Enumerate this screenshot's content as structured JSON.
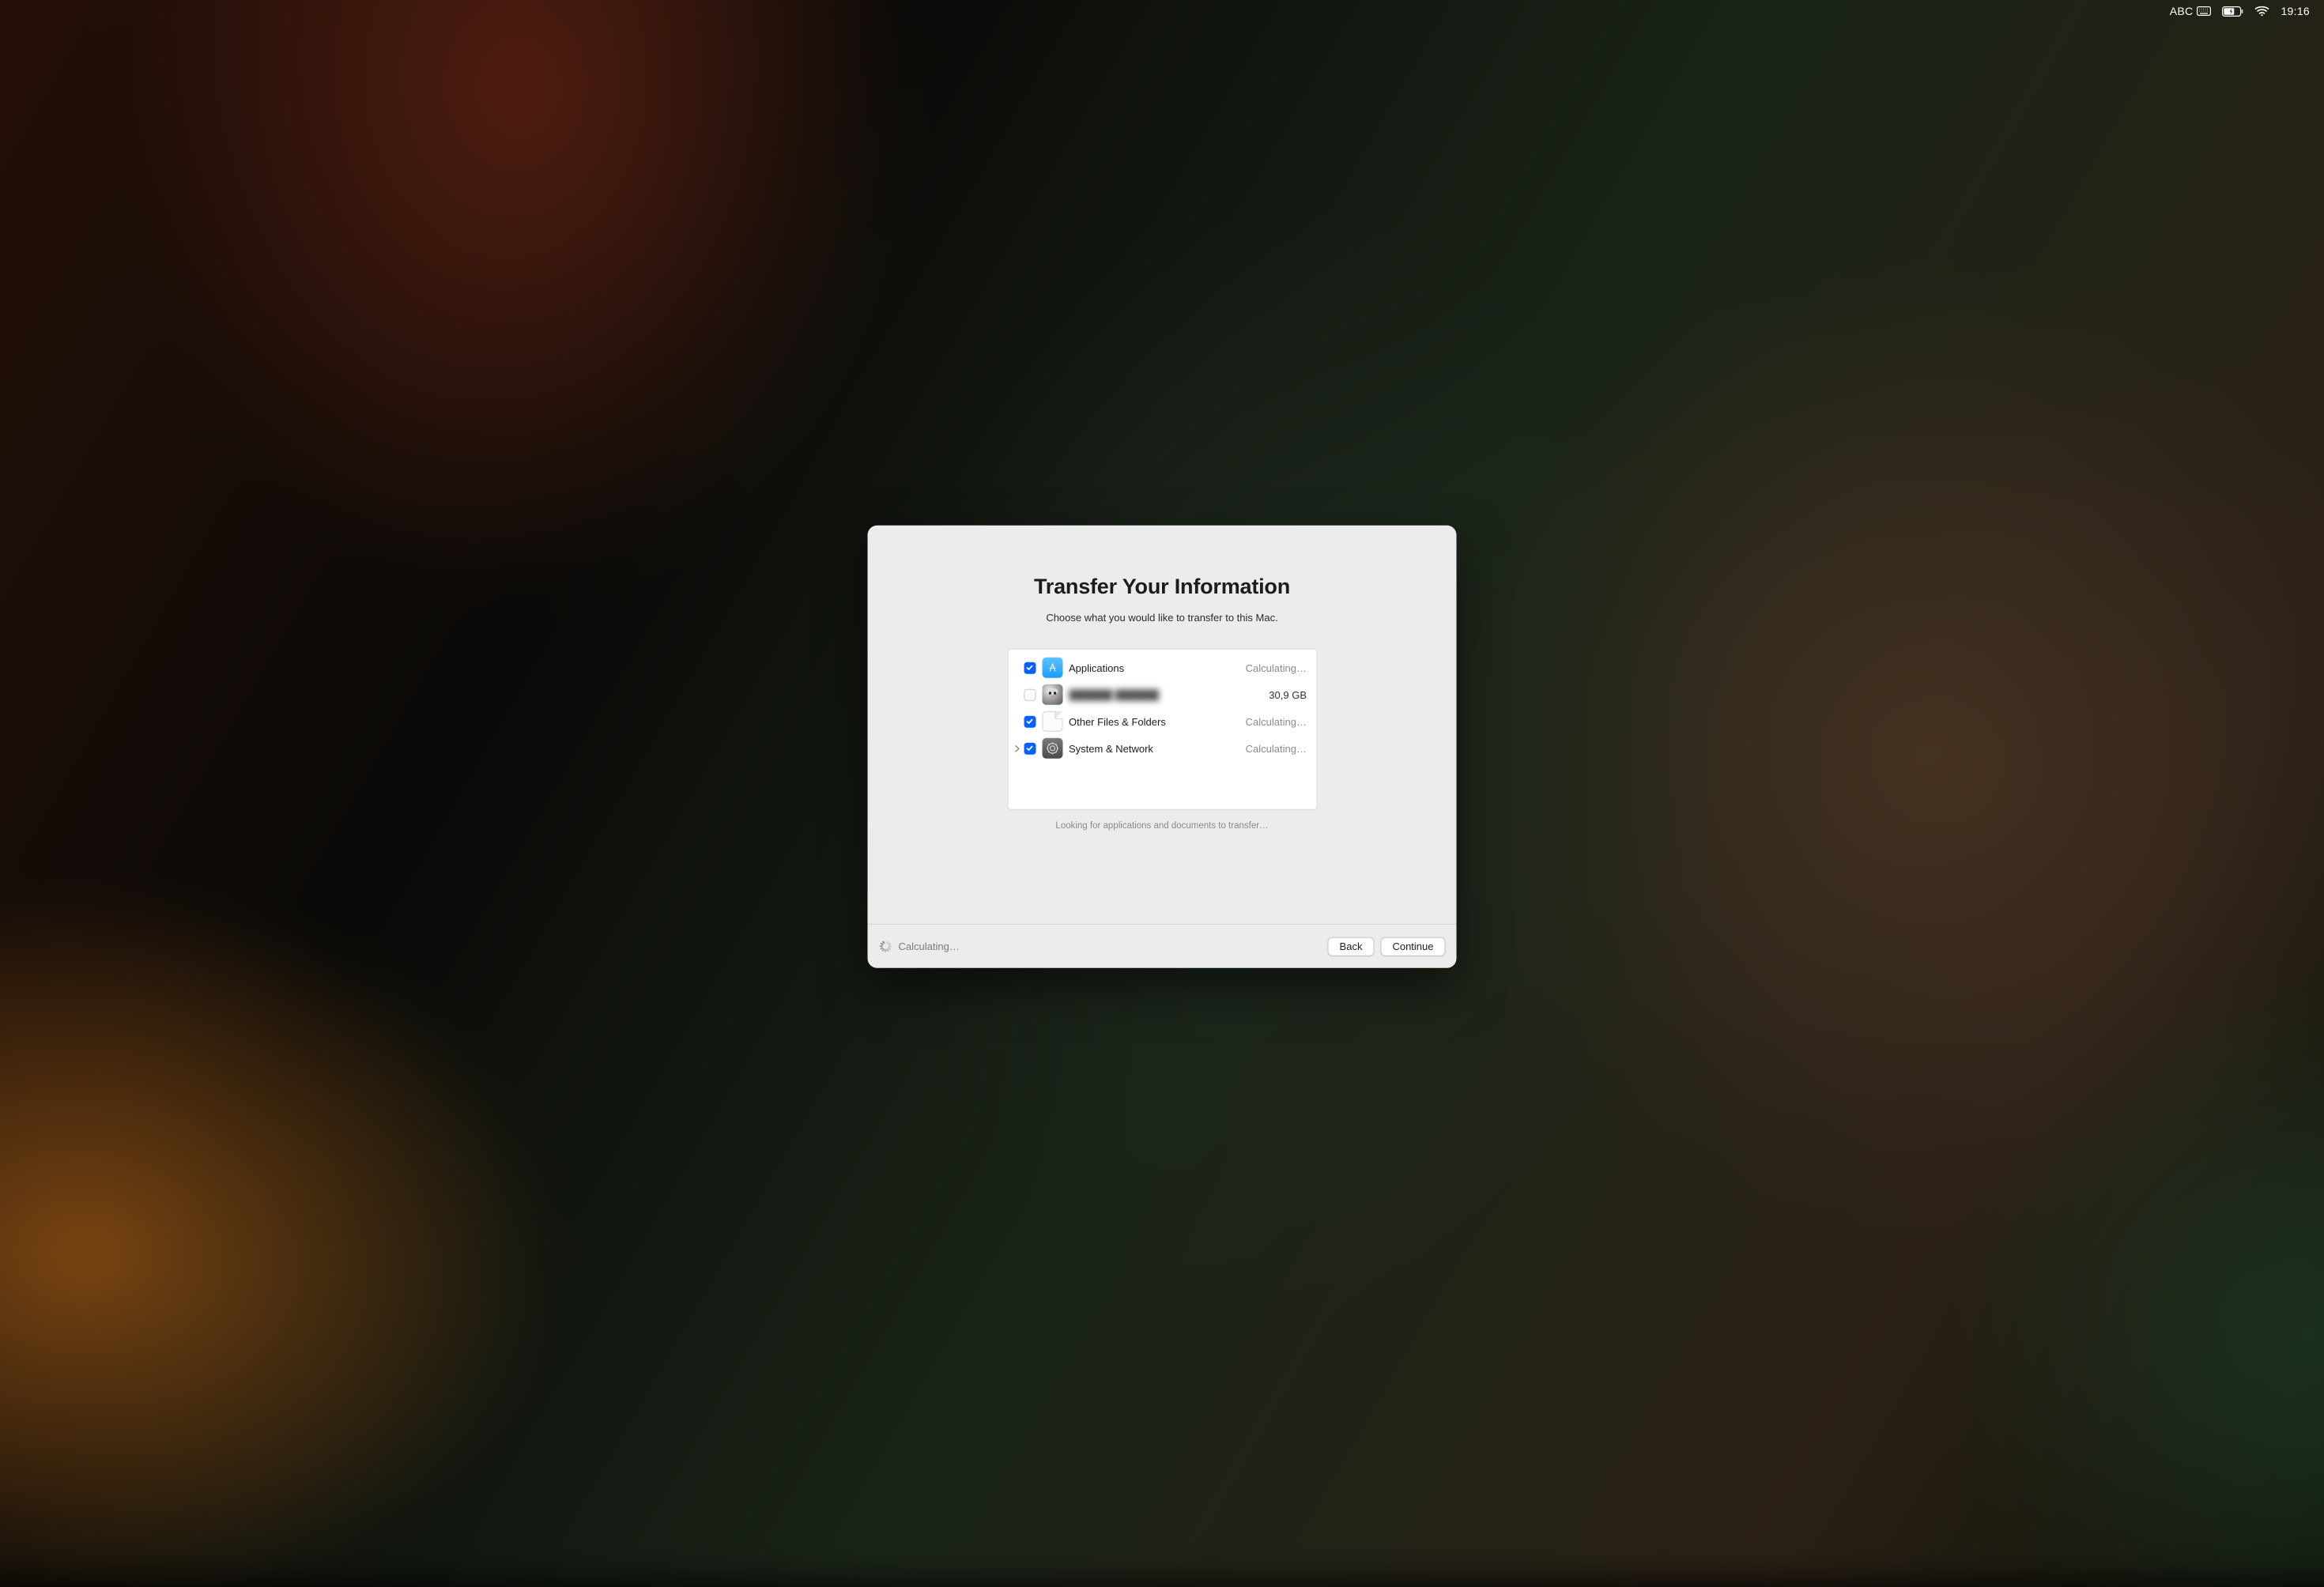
{
  "menubar": {
    "input_source": "ABC",
    "time": "19:16"
  },
  "panel": {
    "title": "Transfer Your Information",
    "subtitle": "Choose what you would like to transfer to this Mac.",
    "status_hint": "Looking for applications and documents to transfer…"
  },
  "items": [
    {
      "label": "Applications",
      "size": "Calculating…",
      "checked": true,
      "icon": "apps",
      "expandable": false,
      "blurred": false
    },
    {
      "label": "██████ ██████",
      "size": "30,9 GB",
      "checked": false,
      "icon": "user",
      "expandable": false,
      "blurred": true
    },
    {
      "label": "Other Files & Folders",
      "size": "Calculating…",
      "checked": true,
      "icon": "doc",
      "expandable": false,
      "blurred": false
    },
    {
      "label": "System & Network",
      "size": "Calculating…",
      "checked": true,
      "icon": "sys",
      "expandable": true,
      "blurred": false
    }
  ],
  "footer": {
    "status": "Calculating…",
    "back_label": "Back",
    "continue_label": "Continue"
  }
}
